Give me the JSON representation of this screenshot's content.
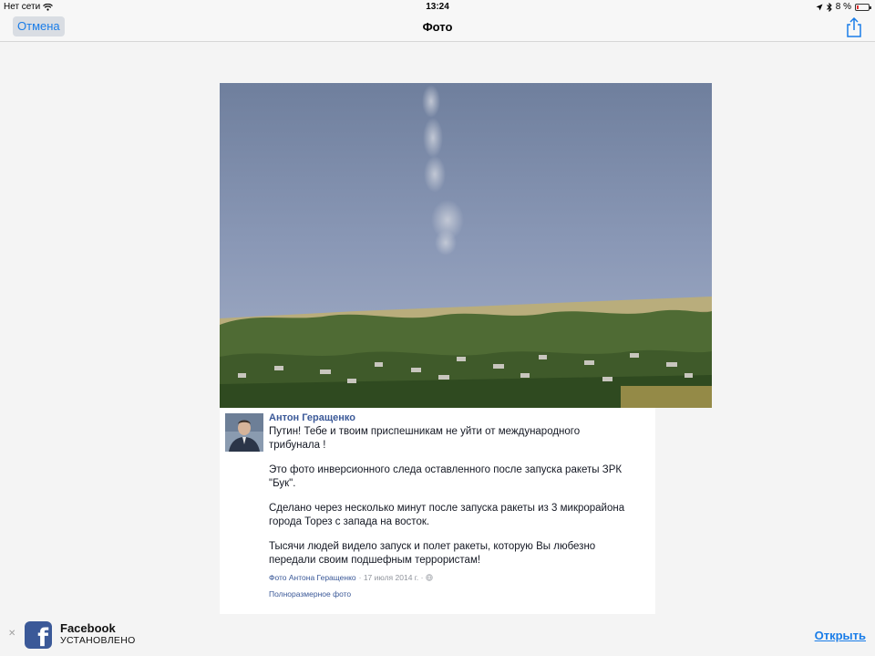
{
  "status_bar": {
    "carrier": "Нет сети",
    "time": "13:24",
    "battery": "8 %"
  },
  "nav": {
    "cancel_label": "Отмена",
    "title": "Фото"
  },
  "post": {
    "author": "Антон Геращенко",
    "paragraphs": [
      "Путин! Тебе и твоим приспешникам не уйти от международного трибунала !",
      "Это фото инверсионного следа оставленного после запуска ракеты ЗРК \"Бук\".",
      "Сделано через несколько минут после запуска ракеты из 3 микрорайона города Торез с запада на восток.",
      "Тысячи людей видело запуск и полет ракеты, которую Вы любезно передали своим подшефным террористам!"
    ],
    "meta_photo_link": "Фото Антона Геращенко",
    "meta_date": "· 17 июля 2014 г. ·",
    "full_size_link": "Полноразмерное фото"
  },
  "banner": {
    "app_name": "Facebook",
    "app_status": "УСТАНОВЛЕНО",
    "open_label": "Открыть"
  },
  "colors": {
    "ios_blue": "#1a7de8",
    "facebook_blue": "#3b5998"
  },
  "icons": [
    "wifi-icon",
    "location-arrow-icon",
    "bluetooth-icon",
    "battery-icon",
    "share-icon",
    "globe-icon",
    "close-icon",
    "facebook-app-icon"
  ]
}
